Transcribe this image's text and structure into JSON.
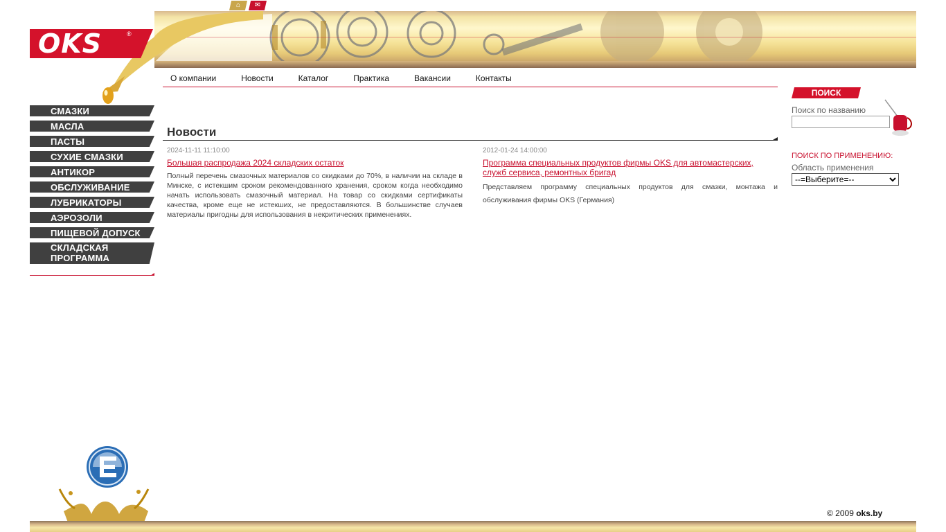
{
  "header": {
    "logo": "OKS",
    "logo_reg": "®",
    "icons": [
      "home-icon",
      "mail-icon"
    ]
  },
  "nav": [
    {
      "label": "О компании"
    },
    {
      "label": "Новости"
    },
    {
      "label": "Каталог"
    },
    {
      "label": "Практика"
    },
    {
      "label": "Вакансии"
    },
    {
      "label": "Контакты"
    }
  ],
  "sidebar": {
    "items": [
      {
        "label": "СМАЗКИ"
      },
      {
        "label": "МАСЛА"
      },
      {
        "label": "ПАСТЫ"
      },
      {
        "label": "СУХИЕ СМАЗКИ"
      },
      {
        "label": "АНТИКОР"
      },
      {
        "label": "ОБСЛУЖИВАНИЕ"
      },
      {
        "label": "ЛУБРИКАТОРЫ"
      },
      {
        "label": "АЭРОЗОЛИ"
      },
      {
        "label": "ПИЩЕВОЙ ДОПУСК"
      },
      {
        "label": "СКЛАДСКАЯ ПРОГРАММА"
      }
    ]
  },
  "main": {
    "title": "Новости",
    "news": [
      {
        "date": "2024-11-11 11:10:00",
        "title": "Большая распродажа 2024 складских остаток",
        "text": "Полный перечень смазочных материалов со скидками до 70%, в наличии на складе в Минске, с истекшим сроком рекомендованного хранения, сроком когда необходимо начать использовать смазочный материал. На товар со скидками сертификаты качества, кроме еще не истекших, не предоставляются. В большинстве случаев материалы пригодны для использования в некритических применениях."
      },
      {
        "date": "2012-01-24 14:00:00",
        "title": "Программа специальных продуктов фирмы OKS для автомастерских, служб сервиса, ремонтных бригад",
        "text": "Представляем программу специальных продуктов для смазки, монтажа и обслуживания фирмы OKS (Германия)"
      }
    ]
  },
  "search": {
    "tab_label": "ПОИСК",
    "by_name_label": "Поиск по названию",
    "by_name_value": "",
    "by_app_title": "ПОИСК ПО ПРИМЕНЕНИЮ:",
    "app_label": "Область применения",
    "app_selected": "--=Выберите=--"
  },
  "footer": {
    "copyright": "© 2009 ",
    "site": "oks.by"
  },
  "colors": {
    "brand_red": "#d4122b",
    "menu_dark": "#404040",
    "gold": "#f3e3a6"
  }
}
